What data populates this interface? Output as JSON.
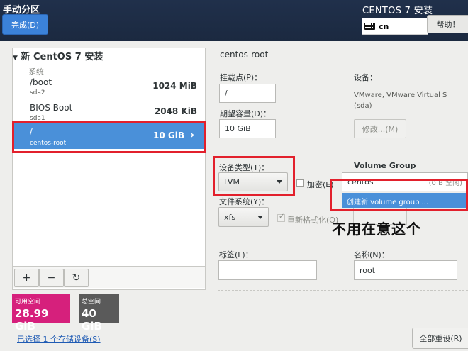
{
  "header": {
    "title": "手动分区",
    "done_label": "完成(D)",
    "product": "CENTOS 7 安装",
    "keyboard_layout": "cn",
    "help_label": "帮助！"
  },
  "left": {
    "install_header": "新 CentOS 7 安装",
    "group_label": "系统",
    "mounts": [
      {
        "name": "/boot",
        "device": "sda2",
        "size": "1024 MiB"
      },
      {
        "name": "BIOS Boot",
        "device": "sda1",
        "size": "2048 KiB"
      },
      {
        "name": "/",
        "device": "centos-root",
        "size": "10 GiB"
      }
    ],
    "selected_index": 2,
    "toolbar": {
      "add": "+",
      "remove": "−",
      "refresh": "↻"
    },
    "available": {
      "label": "可用空间",
      "value": "28.99 GiB"
    },
    "total": {
      "label": "总空间",
      "value": "40 GiB"
    },
    "storage_link": "已选择 1 个存储设备(S)"
  },
  "detail": {
    "section_title": "centos-root",
    "mount_point_label": "挂载点(P)：",
    "mount_point_value": "/",
    "capacity_label": "期望容量(D)：",
    "capacity_value": "10 GiB",
    "device_label": "设备：",
    "device_value": "VMware, VMware Virtual S (sda)",
    "modify_label": "修改...(M)",
    "device_type_label": "设备类型(T)：",
    "device_type_value": "LVM",
    "encrypt_label": "加密(E)",
    "filesystem_label": "文件系统(Y)：",
    "filesystem_value": "xfs",
    "reformat_label": "重新格式化(O)",
    "volume_group_label": "Volume Group",
    "volume_group_value": "centos",
    "volume_group_free": "(0 B 空闲)",
    "create_vg_option": "创建新 volume group ...",
    "annotation": "不用在意这个",
    "label_label": "标签(L)：",
    "label_value": "",
    "name_label": "名称(N)：",
    "name_value": "root",
    "reset_all_label": "全部重设(R)"
  },
  "colors": {
    "header_bg": "#1b2940",
    "accent_blue": "#4a90d9",
    "available_bg": "#d6207c",
    "total_bg": "#5a5a5a",
    "highlight_red": "#e2202c"
  }
}
